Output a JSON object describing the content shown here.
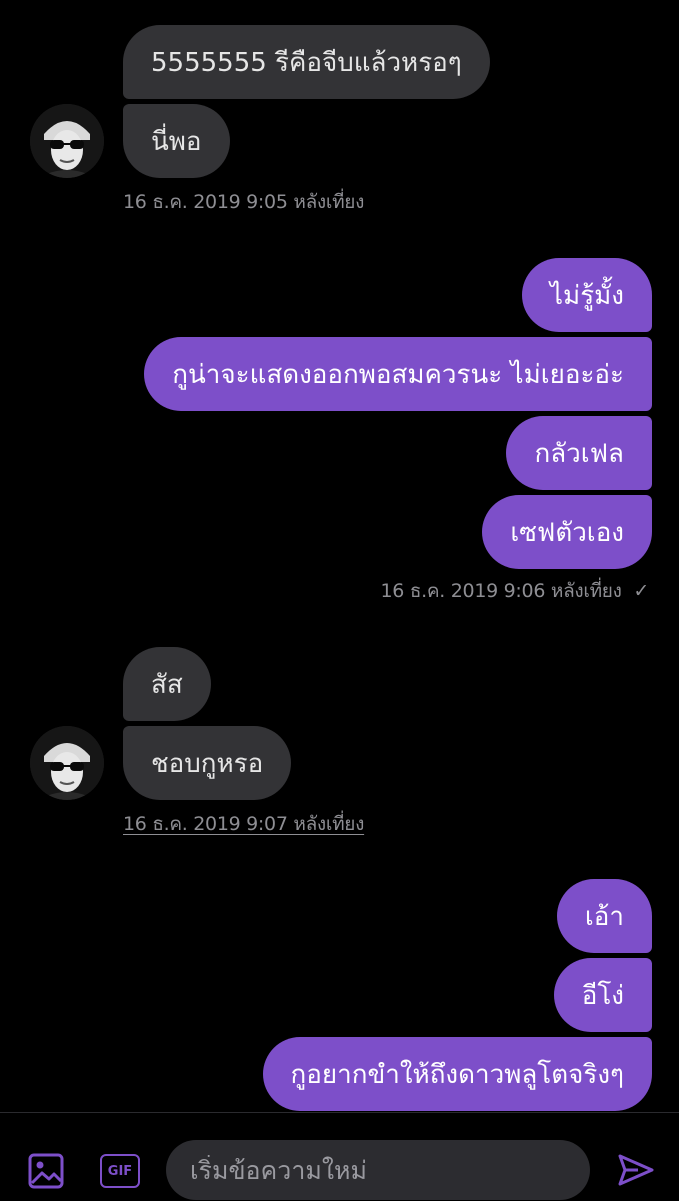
{
  "conversation": {
    "group1": {
      "messages": [
        "5555555 รีคือจีบแล้วหรอๆ",
        "นี่พอ"
      ],
      "timestamp": "16 ธ.ค. 2019 9:05 หลังเที่ยง"
    },
    "group2": {
      "messages": [
        "ไม่รู้มั้ง",
        "กูน่าจะแสดงออกพอสมควรนะ ไม่เยอะอ่ะ",
        "กลัวเฟล",
        "เซฟตัวเอง"
      ],
      "timestamp": "16 ธ.ค. 2019 9:06 หลังเที่ยง",
      "status_icon": "checkmark-icon"
    },
    "group3": {
      "messages": [
        "สัส",
        "ชอบกูหรอ"
      ],
      "timestamp": "16 ธ.ค. 2019 9:07 หลังเที่ยง"
    },
    "group4": {
      "messages": [
        "เอ้า",
        "อีโง่",
        "กูอยากขำให้ถึงดาวพลูโตจริงๆ"
      ]
    }
  },
  "composer": {
    "placeholder": "เริ่มข้อความใหม่",
    "gif_label": "GIF",
    "media_icon": "image-icon",
    "send_icon": "send-icon"
  },
  "colors": {
    "outgoing_bubble": "#7d4fc9",
    "incoming_bubble": "#333336",
    "background": "#000000",
    "accent": "#7d4fc9"
  }
}
